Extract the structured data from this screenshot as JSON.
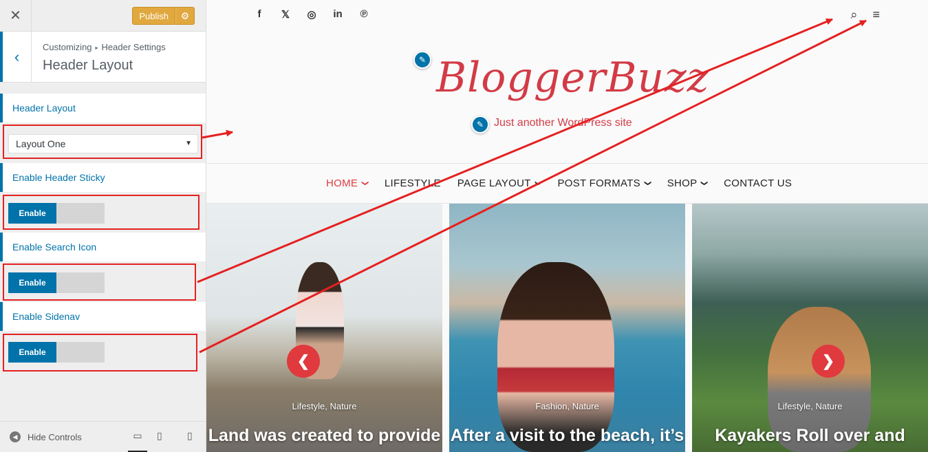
{
  "sidebar": {
    "close_glyph": "✕",
    "publish_label": "Publish",
    "breadcrumb_root": "Customizing",
    "breadcrumb_sep": "▸",
    "breadcrumb_parent": "Header Settings",
    "section_title": "Header Layout",
    "controls": {
      "header_layout_label": "Header Layout",
      "header_layout_value": "Layout One",
      "sticky_label": "Enable Header Sticky",
      "sticky_toggle": "Enable",
      "search_label": "Enable Search Icon",
      "search_toggle": "Enable",
      "sidenav_label": "Enable Sidenav",
      "sidenav_toggle": "Enable"
    },
    "footer": {
      "hide_controls": "Hide Controls"
    }
  },
  "preview": {
    "social_icons": [
      "f",
      "𝕏",
      "◎",
      "in",
      "℗"
    ],
    "site_title": "BloggerBuzz",
    "tagline": "Just another WordPress site",
    "nav": [
      "HOME",
      "LIFESTYLE",
      "PAGE LAYOUT",
      "POST FORMATS",
      "SHOP",
      "CONTACT US"
    ],
    "slides": [
      {
        "category": "Lifestyle, Nature",
        "title": "Land was created to provide"
      },
      {
        "category": "Fashion, Nature",
        "title": "After a visit to the beach, it’s"
      },
      {
        "category": "Lifestyle, Nature",
        "title": "Kayakers Roll over and"
      }
    ],
    "prev_arrow": "❮",
    "next_arrow": "❯"
  },
  "colors": {
    "accent_blue": "#0073aa",
    "publish_orange": "#e0a83e",
    "brand_red": "#d23b46",
    "annotation_red": "#e52020"
  }
}
